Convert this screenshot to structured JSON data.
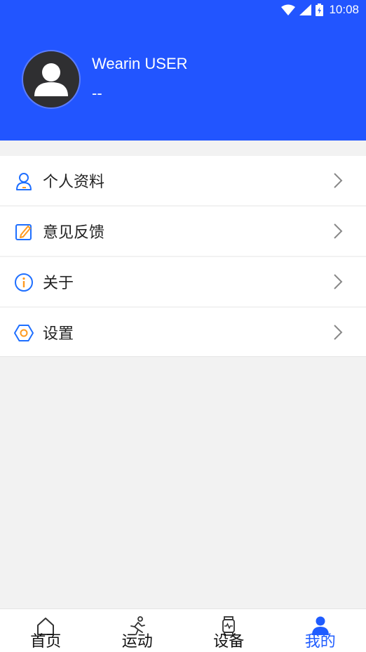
{
  "status_bar": {
    "time": "10:08"
  },
  "profile": {
    "name": "Wearin USER",
    "subtitle": "--"
  },
  "menu": [
    {
      "label": "个人资料",
      "icon": "user-icon",
      "color": "#1f6fff"
    },
    {
      "label": "意见反馈",
      "icon": "edit-icon",
      "color": "#1f6fff"
    },
    {
      "label": "关于",
      "icon": "info-icon",
      "color": "#1f6fff"
    },
    {
      "label": "设置",
      "icon": "settings-icon",
      "color": "#1f6fff"
    }
  ],
  "tabs": [
    {
      "label": "首页",
      "icon": "home-icon",
      "active": false
    },
    {
      "label": "运动",
      "icon": "running-icon",
      "active": false
    },
    {
      "label": "设备",
      "icon": "watch-icon",
      "active": false
    },
    {
      "label": "我的",
      "icon": "person-icon",
      "active": true
    }
  ],
  "colors": {
    "header": "#2255ff",
    "active": "#1f5cff",
    "accent_orange": "#ff9a1f"
  }
}
